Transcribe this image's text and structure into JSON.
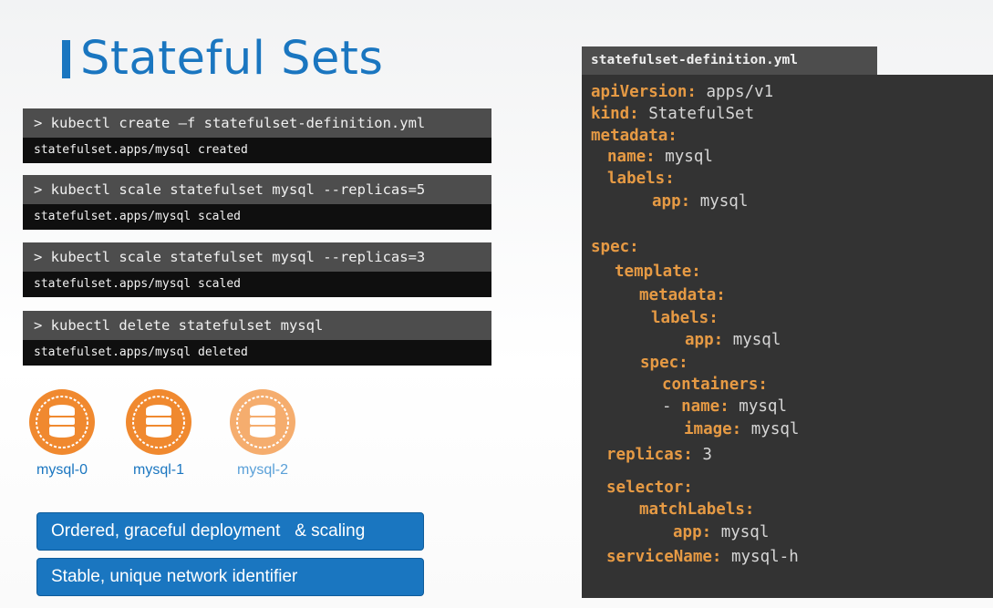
{
  "slide": {
    "title": "Stateful Sets"
  },
  "terminal": [
    {
      "command": "> kubectl create –f statefulset-definition.yml",
      "output": "statefulset.apps/mysql created"
    },
    {
      "command": "> kubectl scale statefulset mysql --replicas=5",
      "output": "statefulset.apps/mysql scaled"
    },
    {
      "command": "> kubectl scale statefulset mysql --replicas=3",
      "output": "statefulset.apps/mysql scaled"
    },
    {
      "command": "> kubectl delete statefulset mysql",
      "output": "statefulset.apps/mysql deleted"
    }
  ],
  "pods": [
    {
      "name": "mysql-0",
      "icon": "database-icon"
    },
    {
      "name": "mysql-1",
      "icon": "database-icon"
    },
    {
      "name": "mysql-2",
      "icon": "database-icon"
    }
  ],
  "features": [
    "Ordered, graceful deployment   & scaling",
    "Stable, unique network identifier"
  ],
  "editor": {
    "filename": "statefulset-definition.yml",
    "lines": [
      {
        "key": "apiVersion:",
        "value": " apps/v1"
      },
      {
        "key": "kind:",
        "value": " StatefulSet"
      },
      {
        "key": "metadata:",
        "value": ""
      },
      {
        "key": "name:",
        "value": " mysql"
      },
      {
        "key": "labels:",
        "value": ""
      },
      {
        "key": "app:",
        "value": " mysql"
      },
      {
        "key": "spec:",
        "value": ""
      },
      {
        "key": "template:",
        "value": ""
      },
      {
        "key": "metadata:",
        "value": ""
      },
      {
        "key": "labels:",
        "value": ""
      },
      {
        "key": "app:",
        "value": " mysql"
      },
      {
        "key": "spec:",
        "value": ""
      },
      {
        "key": "containers:",
        "value": ""
      },
      {
        "key": "- name:",
        "value": " mysql",
        "dash": "- "
      },
      {
        "key": "image:",
        "value": " mysql"
      },
      {
        "key": "replicas:",
        "value": " 3"
      },
      {
        "key": "selector:",
        "value": ""
      },
      {
        "key": "matchLabels:",
        "value": ""
      },
      {
        "key": "app:",
        "value": " mysql"
      },
      {
        "key": "serviceName:",
        "value": " mysql-h"
      }
    ]
  },
  "colors": {
    "title": "#1a76c0",
    "yaml_key": "#e69a44",
    "pod_orange": "#f0892f",
    "pod_orange_faded": "#f5ad6e"
  }
}
